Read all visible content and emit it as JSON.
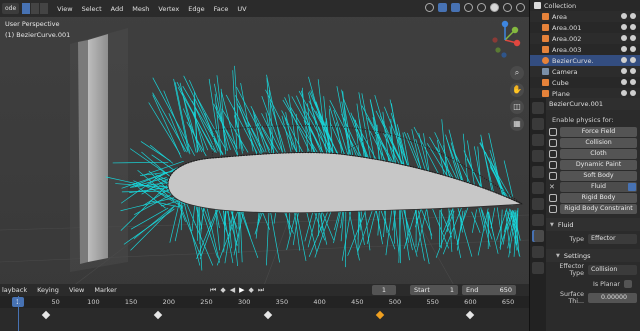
{
  "header": {
    "mode_label": "ode",
    "menu": [
      "View",
      "Select",
      "Add",
      "Mesh",
      "Vertex",
      "Edge",
      "Face",
      "UV"
    ]
  },
  "viewport": {
    "perspective_label": "User Perspective",
    "object_label": "(1) BezierCurve.001"
  },
  "timeline": {
    "menu": [
      "layback",
      "Keying",
      "View",
      "Marker"
    ],
    "current_frame": "1",
    "frame_field": "1",
    "start_label": "Start",
    "start_value": "1",
    "end_label": "End",
    "end_value": "650",
    "ticks": [
      "50",
      "100",
      "150",
      "200",
      "250",
      "300",
      "350",
      "400",
      "450",
      "500",
      "550",
      "600",
      "650"
    ]
  },
  "outliner": {
    "items": [
      {
        "label": "Collection"
      },
      {
        "label": "Area"
      },
      {
        "label": "Area.001"
      },
      {
        "label": "Area.002"
      },
      {
        "label": "Area.003"
      },
      {
        "label": "BezierCurve."
      },
      {
        "label": "Camera"
      },
      {
        "label": "Cube"
      },
      {
        "label": "Plane"
      }
    ]
  },
  "properties": {
    "object_name": "BezierCurve.001",
    "enable_label": "Enable physics for:",
    "buttons": [
      "Force Field",
      "Collision",
      "Cloth",
      "Dynamic Paint",
      "Soft Body",
      "Fluid",
      "Rigid Body",
      "Rigid Body Constraint"
    ],
    "fluid_section": "Fluid",
    "type_label": "Type",
    "type_value": "Effector",
    "settings_section": "Settings",
    "effector_type_label": "Effector Type",
    "effector_type_value": "Collision",
    "is_planar_label": "Is Planar",
    "surface_label": "Surface Thi...",
    "surface_value": "0.00000"
  },
  "colors": {
    "accent": "#4772b3",
    "hair": "#19d4d8",
    "keyframe_selected": "#f0a020"
  }
}
